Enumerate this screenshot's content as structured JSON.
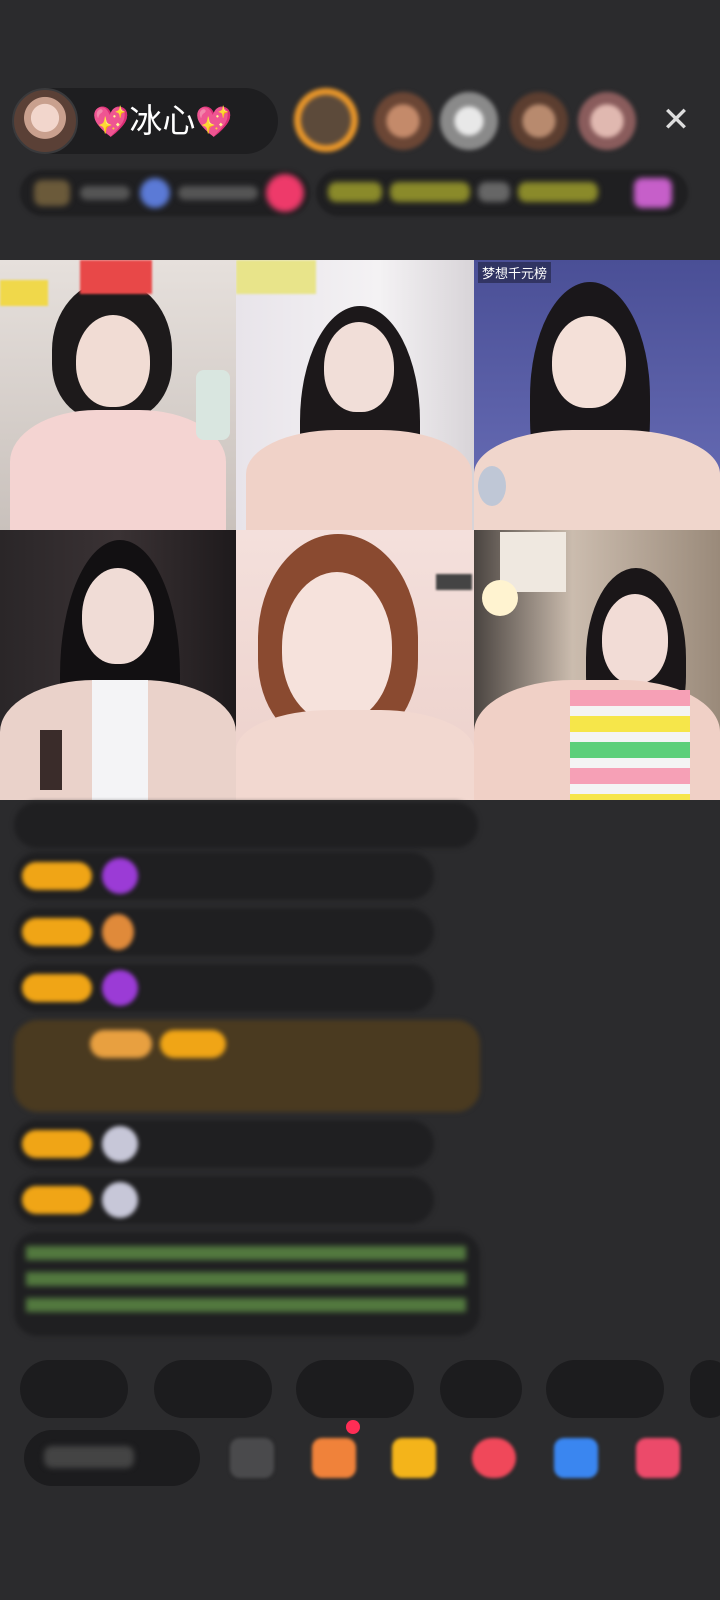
{
  "live_room": {
    "host_name": "冰心",
    "heart_left": "💖",
    "heart_right": "💖",
    "close_glyph": "✕"
  },
  "video_grid": {
    "cells": [
      {
        "tag": ""
      },
      {
        "tag": ""
      },
      {
        "tag": "梦想千元榜"
      },
      {
        "tag": ""
      },
      {
        "tag": ""
      },
      {
        "tag": ""
      }
    ]
  },
  "icons": {
    "close": "close-icon",
    "gift": "gift-icon",
    "gem": "gem-icon"
  },
  "colors": {
    "background": "#2b2b2d",
    "badge": "#f0a516",
    "gem_purple": "#9b3bd6",
    "chat_green": "#7ab85a",
    "chat_blue": "#49a6c9"
  }
}
